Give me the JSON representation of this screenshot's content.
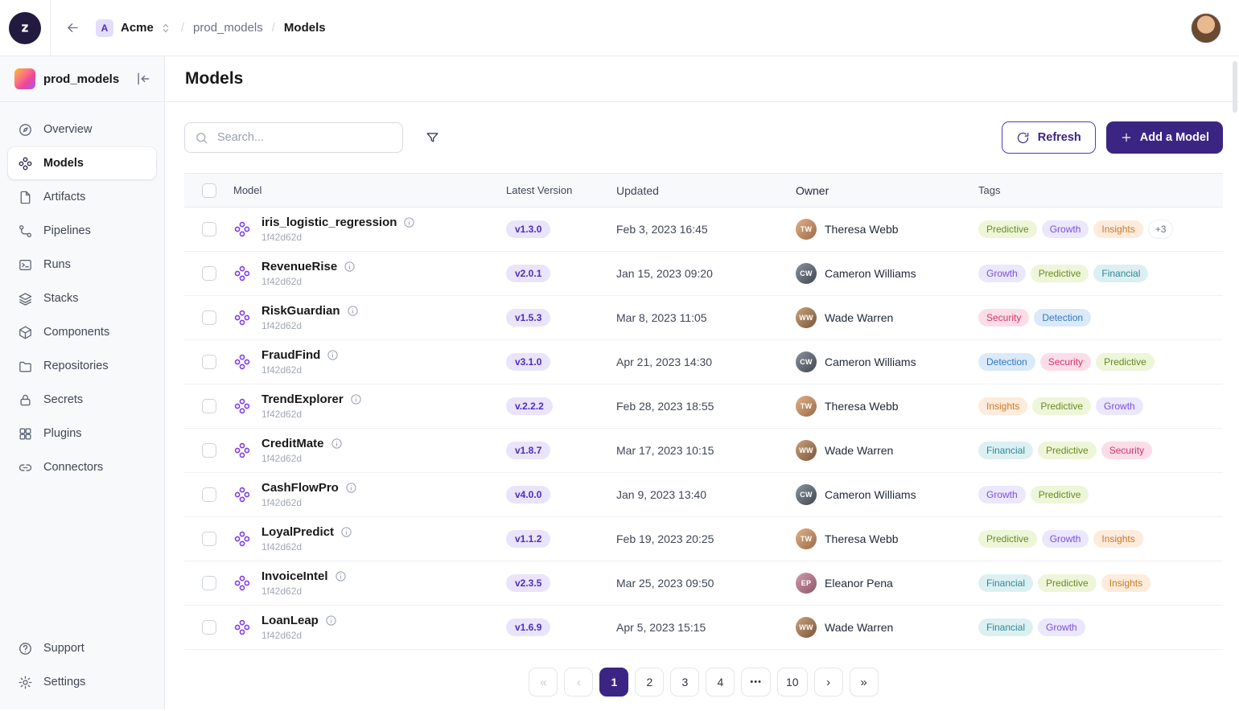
{
  "topbar": {
    "org_badge": "A",
    "org_name": "Acme",
    "separator": "/",
    "breadcrumb_project": "prod_models",
    "breadcrumb_current": "Models"
  },
  "sidebar": {
    "project_name": "prod_models",
    "items": [
      {
        "id": "overview",
        "label": "Overview",
        "icon": "overview-icon",
        "active": false
      },
      {
        "id": "models",
        "label": "Models",
        "icon": "models-icon",
        "active": true
      },
      {
        "id": "artifacts",
        "label": "Artifacts",
        "icon": "artifacts-icon",
        "active": false
      },
      {
        "id": "pipelines",
        "label": "Pipelines",
        "icon": "pipelines-icon",
        "active": false
      },
      {
        "id": "runs",
        "label": "Runs",
        "icon": "runs-icon",
        "active": false
      },
      {
        "id": "stacks",
        "label": "Stacks",
        "icon": "stacks-icon",
        "active": false
      },
      {
        "id": "components",
        "label": "Components",
        "icon": "components-icon",
        "active": false
      },
      {
        "id": "repositories",
        "label": "Repositories",
        "icon": "repositories-icon",
        "active": false
      },
      {
        "id": "secrets",
        "label": "Secrets",
        "icon": "secrets-icon",
        "active": false
      },
      {
        "id": "plugins",
        "label": "Plugins",
        "icon": "plugins-icon",
        "active": false
      },
      {
        "id": "connectors",
        "label": "Connectors",
        "icon": "connectors-icon",
        "active": false
      }
    ],
    "footer_items": [
      {
        "id": "support",
        "label": "Support",
        "icon": "support-icon"
      },
      {
        "id": "settings",
        "label": "Settings",
        "icon": "settings-icon"
      }
    ]
  },
  "page": {
    "title": "Models"
  },
  "toolbar": {
    "search_placeholder": "Search...",
    "refresh_label": "Refresh",
    "add_model_label": "Add a Model"
  },
  "table": {
    "columns": [
      "Model",
      "Latest Version",
      "Updated",
      "Owner",
      "Tags"
    ],
    "rows": [
      {
        "name": "iris_logistic_regression",
        "hash": "1f42d62d",
        "version": "v1.3.0",
        "updated": "Feb 3, 2023 16:45",
        "owner": "Theresa Webb",
        "tags": [
          "Predictive",
          "Growth",
          "Insights"
        ],
        "more": "+3"
      },
      {
        "name": "RevenueRise",
        "hash": "1f42d62d",
        "version": "v2.0.1",
        "updated": "Jan 15, 2023 09:20",
        "owner": "Cameron Williams",
        "tags": [
          "Growth",
          "Predictive",
          "Financial"
        ]
      },
      {
        "name": "RiskGuardian",
        "hash": "1f42d62d",
        "version": "v1.5.3",
        "updated": "Mar 8, 2023 11:05",
        "owner": "Wade Warren",
        "tags": [
          "Security",
          "Detection"
        ]
      },
      {
        "name": "FraudFind",
        "hash": "1f42d62d",
        "version": "v3.1.0",
        "updated": "Apr 21, 2023 14:30",
        "owner": "Cameron Williams",
        "tags": [
          "Detection",
          "Security",
          "Predictive"
        ]
      },
      {
        "name": "TrendExplorer",
        "hash": "1f42d62d",
        "version": "v.2.2.2",
        "updated": "Feb 28, 2023 18:55",
        "owner": "Theresa Webb",
        "tags": [
          "Insights",
          "Predictive",
          "Growth"
        ]
      },
      {
        "name": "CreditMate",
        "hash": "1f42d62d",
        "version": "v1.8.7",
        "updated": "Mar 17, 2023 10:15",
        "owner": "Wade Warren",
        "tags": [
          "Financial",
          "Predictive",
          "Security"
        ]
      },
      {
        "name": "CashFlowPro",
        "hash": "1f42d62d",
        "version": "v4.0.0",
        "updated": "Jan 9, 2023 13:40",
        "owner": "Cameron Williams",
        "tags": [
          "Growth",
          "Predictive"
        ]
      },
      {
        "name": "LoyalPredict",
        "hash": "1f42d62d",
        "version": "v1.1.2",
        "updated": "Feb 19, 2023 20:25",
        "owner": "Theresa Webb",
        "tags": [
          "Predictive",
          "Growth",
          "Insights"
        ]
      },
      {
        "name": "InvoiceIntel",
        "hash": "1f42d62d",
        "version": "v2.3.5",
        "updated": "Mar 25, 2023 09:50",
        "owner": "Eleanor Pena",
        "tags": [
          "Financial",
          "Predictive",
          "Insights"
        ]
      },
      {
        "name": "LoanLeap",
        "hash": "1f42d62d",
        "version": "v1.6.9",
        "updated": "Apr 5, 2023 15:15",
        "owner": "Wade Warren",
        "tags": [
          "Financial",
          "Growth"
        ]
      }
    ]
  },
  "pagination": {
    "items": [
      {
        "type": "first",
        "label": "«",
        "disabled": true
      },
      {
        "type": "prev",
        "label": "‹",
        "disabled": true
      },
      {
        "type": "page",
        "label": "1",
        "active": true
      },
      {
        "type": "page",
        "label": "2"
      },
      {
        "type": "page",
        "label": "3"
      },
      {
        "type": "page",
        "label": "4"
      },
      {
        "type": "ellipsis",
        "label": "•••"
      },
      {
        "type": "page",
        "label": "10"
      },
      {
        "type": "next",
        "label": "›"
      },
      {
        "type": "last",
        "label": "»"
      }
    ]
  },
  "colors": {
    "primary": "#3b2583",
    "model_icon": "#7c3aed",
    "version_badge": {
      "bg": "#eae4fb",
      "text": "#4b2ebc"
    },
    "tag_colors": {
      "Predictive": {
        "bg": "#edf6d8",
        "text": "#6a8a22"
      },
      "Growth": {
        "bg": "#ebe7fd",
        "text": "#7a4fe0"
      },
      "Insights": {
        "bg": "#fdebdc",
        "text": "#c97a28"
      },
      "Financial": {
        "bg": "#dcf0f2",
        "text": "#2f8796"
      },
      "Security": {
        "bg": "#fbdde8",
        "text": "#d6336c"
      },
      "Detection": {
        "bg": "#dbe9f9",
        "text": "#3178c6"
      }
    }
  }
}
